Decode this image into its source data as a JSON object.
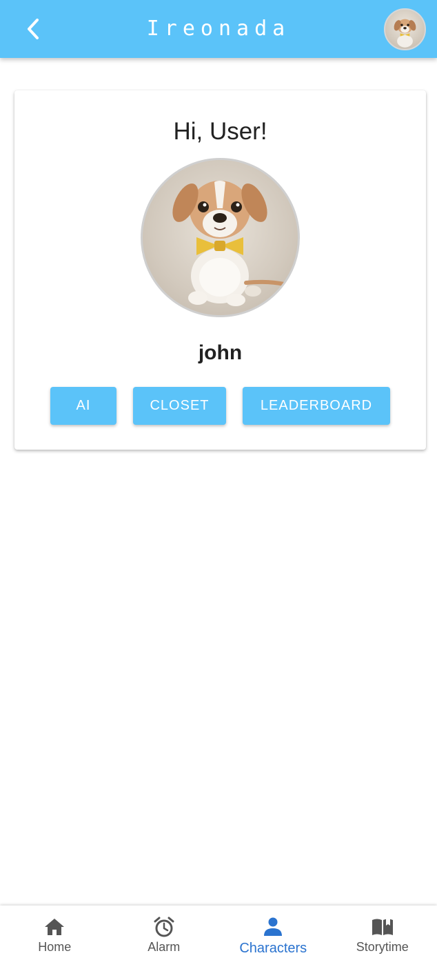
{
  "appbar": {
    "title": "Ireonada",
    "back_icon": "chevron-left-icon",
    "avatar_icon": "puppy-avatar"
  },
  "profile": {
    "greeting": "Hi, User!",
    "username": "john",
    "avatar_icon": "puppy-avatar"
  },
  "actions": {
    "ai_label": "AI",
    "closet_label": "CLOSET",
    "leaderboard_label": "LEADERBOARD"
  },
  "bottom_nav": {
    "items": [
      {
        "label": "Home",
        "icon": "home-icon",
        "active": false
      },
      {
        "label": "Alarm",
        "icon": "alarm-clock-icon",
        "active": false
      },
      {
        "label": "Characters",
        "icon": "person-icon",
        "active": true
      },
      {
        "label": "Storytime",
        "icon": "book-icon",
        "active": false
      }
    ]
  },
  "colors": {
    "primary": "#5bc3f9",
    "active_nav": "#2a73cf",
    "inactive_nav": "#555555",
    "text": "#222222"
  }
}
